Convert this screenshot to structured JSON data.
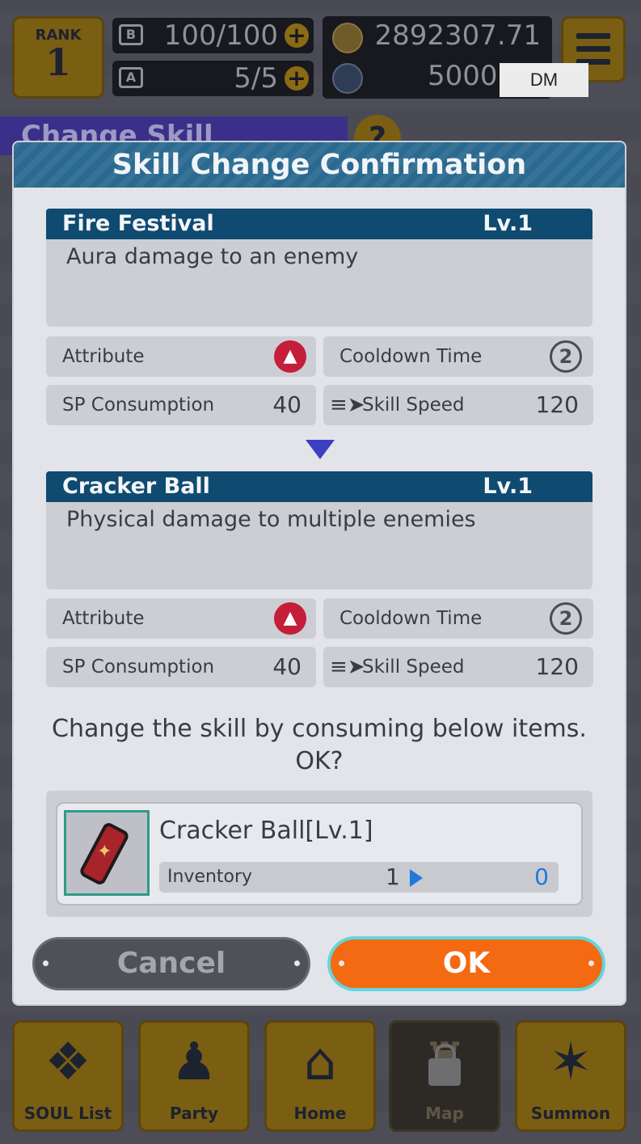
{
  "hud": {
    "rank_label": "RANK",
    "rank_value": "1",
    "stamina": "100/100",
    "stamina_icon_text": "B",
    "ap": "5/5",
    "ap_icon_text": "A",
    "gold": "2892307.71",
    "dm_currency": "5000",
    "dm_tag": "DM"
  },
  "page_header": {
    "title": "Change Skill",
    "help": "?"
  },
  "modal": {
    "title": "Skill Change Confirmation",
    "current_skill": {
      "name": "Fire Festival",
      "level": "Lv.1",
      "description": "Aura damage to an enemy",
      "attribute_label": "Attribute",
      "cooldown_label": "Cooldown Time",
      "cooldown_value": "2",
      "sp_label": "SP Consumption",
      "sp_value": "40",
      "speed_label": "Skill Speed",
      "speed_value": "120"
    },
    "new_skill": {
      "name": "Cracker Ball",
      "level": "Lv.1",
      "description": "Physical damage to multiple enemies",
      "attribute_label": "Attribute",
      "cooldown_label": "Cooldown Time",
      "cooldown_value": "2",
      "sp_label": "SP Consumption",
      "sp_value": "40",
      "speed_label": "Skill Speed",
      "speed_value": "120"
    },
    "confirm_line1": "Change the skill by consuming below items.",
    "confirm_line2": "OK?",
    "item": {
      "name": "Cracker Ball[Lv.1]",
      "inventory_label": "Inventory",
      "inventory_from": "1",
      "inventory_to": "0"
    },
    "cancel_label": "Cancel",
    "ok_label": "OK"
  },
  "nav": [
    {
      "label": "SOUL List",
      "icon": "soul-list-icon"
    },
    {
      "label": "Party",
      "icon": "party-icon"
    },
    {
      "label": "Home",
      "icon": "home-icon"
    },
    {
      "label": "Map",
      "icon": "map-icon"
    },
    {
      "label": "Summon",
      "icon": "summon-icon"
    }
  ],
  "colors": {
    "accent_orange": "#f46a12",
    "ok_outline": "#62d6e0",
    "header_blue": "#2a6a90",
    "skill_title_blue": "#0f4a71",
    "fire_red": "#c41e3a",
    "arrow_indigo": "#3d3fc0"
  }
}
